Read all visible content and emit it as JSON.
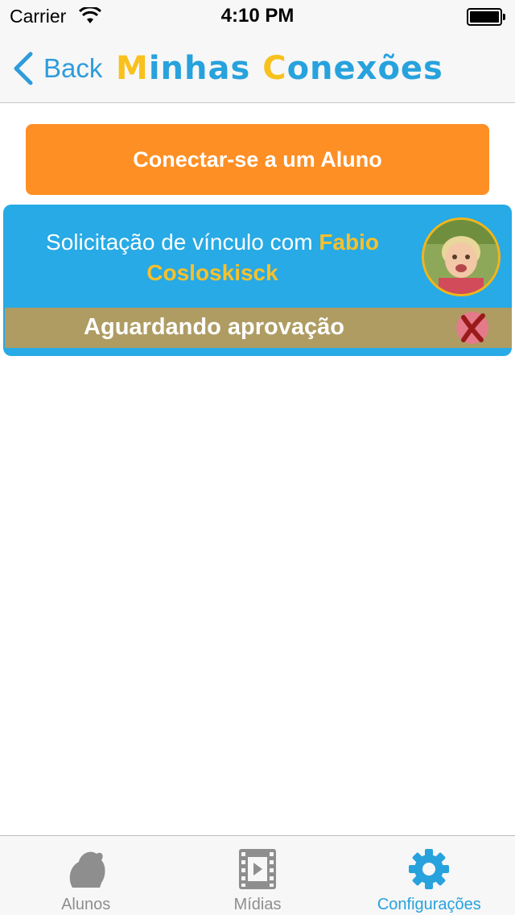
{
  "status_bar": {
    "carrier": "Carrier",
    "time": "4:10 PM"
  },
  "nav": {
    "back_label": "Back",
    "title_part1_accent": "M",
    "title_part1_rest": "inhas ",
    "title_part2_accent": "C",
    "title_part2_rest": "onexões"
  },
  "connect_button": {
    "label": "Conectar-se a um Aluno"
  },
  "request": {
    "text": "Solicitação de vínculo com",
    "student_name": "Fabio Cosloskisck",
    "status": "Aguardando aprovação"
  },
  "tab_bar": {
    "tabs": [
      {
        "label": "Alunos",
        "icon": "student-icon",
        "active": false
      },
      {
        "label": "Mídias",
        "icon": "film-icon",
        "active": false
      },
      {
        "label": "Configurações",
        "icon": "gear-icon",
        "active": true
      }
    ]
  },
  "colors": {
    "accent_blue": "#27a2dd",
    "accent_yellow": "#f8c11e",
    "button_orange": "#fe8f24",
    "card_blue": "#27aae5",
    "status_tan": "#ae9c63"
  }
}
